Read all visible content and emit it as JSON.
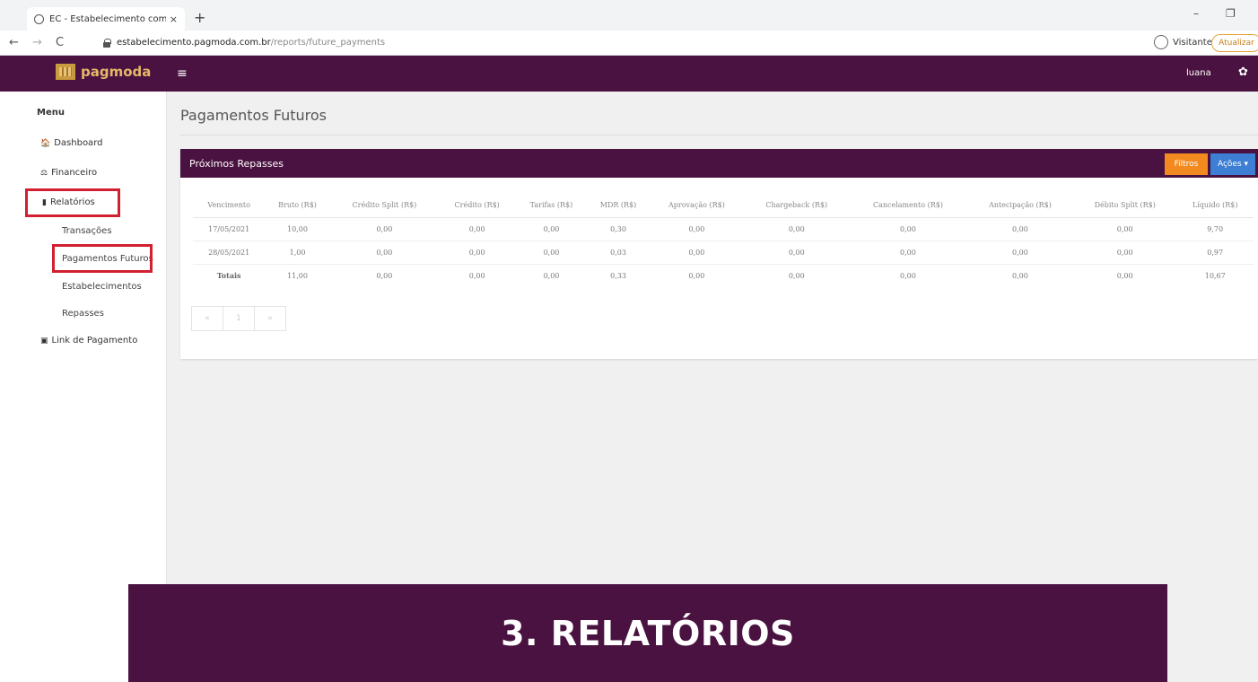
{
  "browser": {
    "tab_title": "EC - Estabelecimento comercial",
    "tab_close": "×",
    "new_tab": "+",
    "minimize": "–",
    "restore": "❐",
    "url_host": "estabelecimento.pagmoda.com.br",
    "url_path": "/reports/future_payments",
    "profile_label": "Visitante",
    "update_label": "Atualizar"
  },
  "header": {
    "logo_text": "pagmoda",
    "menu_icon": "≡",
    "username": "luana",
    "settings_icon": "✿"
  },
  "sidebar": {
    "title": "Menu",
    "items": [
      {
        "label": "Dashboard",
        "icon": "🏠"
      },
      {
        "label": "Financeiro",
        "icon": "⚖"
      },
      {
        "label": "Relatórios",
        "icon": "▮"
      },
      {
        "label": "Link de Pagamento",
        "icon": "▣"
      }
    ],
    "sub_items": [
      "Transações",
      "Pagamentos Futuros",
      "Estabelecimentos",
      "Repasses"
    ]
  },
  "main": {
    "page_title": "Pagamentos Futuros",
    "panel_title": "Próximos Repasses",
    "filter_button": "Filtros",
    "actions_button": "Ações ▾",
    "table": {
      "columns": [
        "Vencimento",
        "Bruto (R$)",
        "Crédito Split (R$)",
        "Crédito (R$)",
        "Tarifas (R$)",
        "MDR (R$)",
        "Aprovação (R$)",
        "Chargeback (R$)",
        "Cancelamento (R$)",
        "Antecipação (R$)",
        "Débito Split (R$)",
        "Líquido (R$)"
      ],
      "rows": [
        [
          "17/05/2021",
          "10,00",
          "0,00",
          "0,00",
          "0,00",
          "0,30",
          "0,00",
          "0,00",
          "0,00",
          "0,00",
          "0,00",
          "9,70"
        ],
        [
          "28/05/2021",
          "1,00",
          "0,00",
          "0,00",
          "0,00",
          "0,03",
          "0,00",
          "0,00",
          "0,00",
          "0,00",
          "0,00",
          "0,97"
        ],
        [
          "Totais",
          "11,00",
          "0,00",
          "0,00",
          "0,00",
          "0,33",
          "0,00",
          "0,00",
          "0,00",
          "0,00",
          "0,00",
          "10,67"
        ]
      ]
    },
    "pagination": {
      "prev": "«",
      "page": "1",
      "next": "»"
    }
  },
  "banner": {
    "text": "3. RELATÓRIOS"
  },
  "colors": {
    "brand_purple": "#4a1240",
    "logo_gold": "#e4b86a",
    "filter_orange": "#f28a20",
    "actions_blue": "#3d7fd4",
    "highlight_red": "#d1202f"
  }
}
